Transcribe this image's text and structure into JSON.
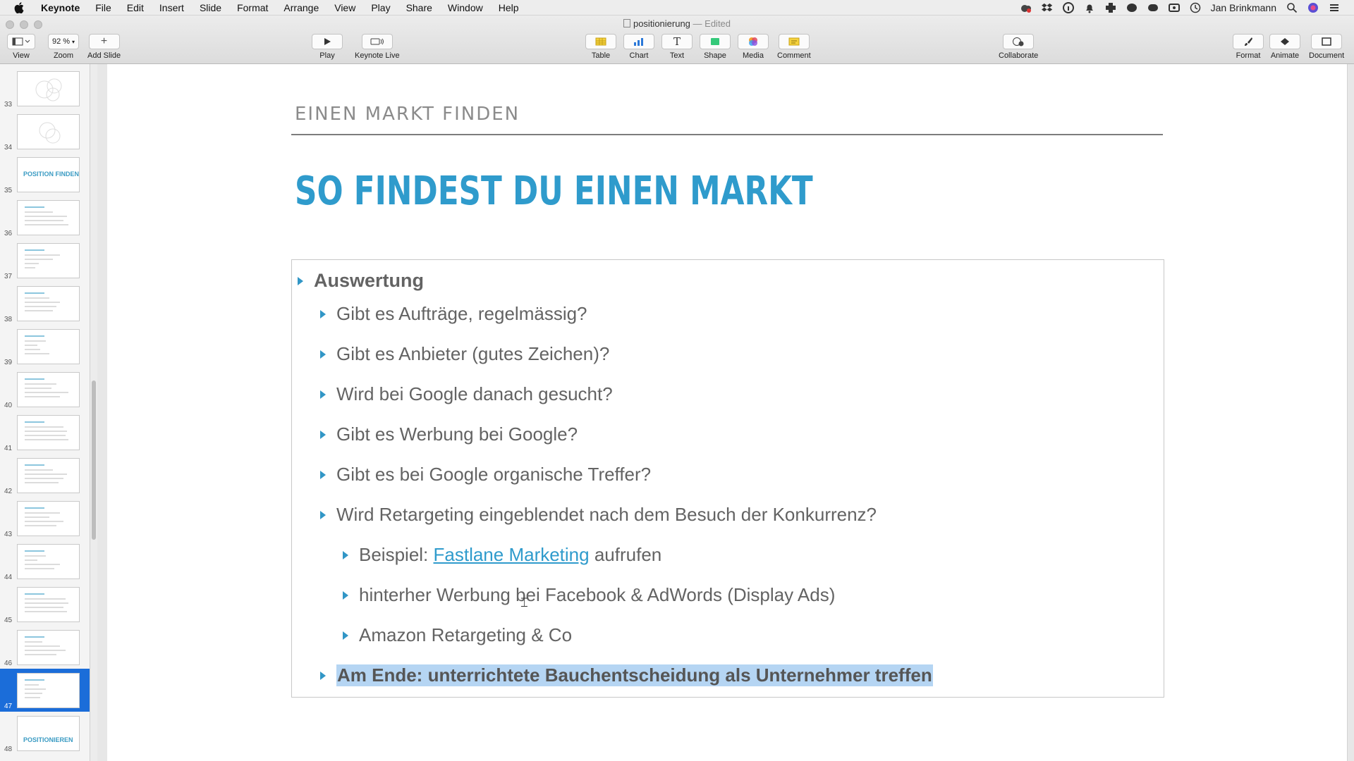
{
  "menubar": {
    "app": "Keynote",
    "items": [
      "File",
      "Edit",
      "Insert",
      "Slide",
      "Format",
      "Arrange",
      "View",
      "Play",
      "Share",
      "Window",
      "Help"
    ],
    "user": "Jan Brinkmann"
  },
  "window": {
    "title": "positionierung",
    "status": "— Edited"
  },
  "toolbar": {
    "view": "View",
    "zoom_value": "92 %",
    "zoom": "Zoom",
    "add_slide": "Add Slide",
    "play": "Play",
    "keynote_live": "Keynote Live",
    "table": "Table",
    "chart": "Chart",
    "text": "Text",
    "shape": "Shape",
    "media": "Media",
    "comment": "Comment",
    "collaborate": "Collaborate",
    "format": "Format",
    "animate": "Animate",
    "document": "Document"
  },
  "sidebar": {
    "slides": [
      {
        "num": "33"
      },
      {
        "num": "34"
      },
      {
        "num": "35",
        "title": "POSITION FINDEN"
      },
      {
        "num": "36"
      },
      {
        "num": "37"
      },
      {
        "num": "38"
      },
      {
        "num": "39"
      },
      {
        "num": "40"
      },
      {
        "num": "41"
      },
      {
        "num": "42"
      },
      {
        "num": "43"
      },
      {
        "num": "44"
      },
      {
        "num": "45"
      },
      {
        "num": "46"
      },
      {
        "num": "47",
        "selected": true
      },
      {
        "num": "48",
        "title": "POSITIONIEREN"
      }
    ]
  },
  "slide": {
    "eyebrow": "EINEN MARKT FINDEN",
    "headline": "SO FINDEST DU EINEN MARKT",
    "bullets": {
      "b0": "Auswertung",
      "b1": "Gibt es Aufträge, regelmässig?",
      "b2": "Gibt es Anbieter (gutes Zeichen)?",
      "b3": "Wird bei Google danach gesucht?",
      "b4": "Gibt es Werbung bei Google?",
      "b5": "Gibt es bei Google organische Treffer?",
      "b6": "Wird Retargeting eingeblendet nach dem Besuch der Konkurrenz?",
      "b7_prefix": "Beispiel: ",
      "b7_link": "Fastlane Marketing",
      "b7_suffix": " aufrufen",
      "b8": "hinterher Werbung bei Facebook & AdWords (Display Ads)",
      "b9": "Amazon Retargeting & Co",
      "b10": "Am Ende: unterrichtete Bauchentscheidung als Unternehmer treffen"
    }
  },
  "colors": {
    "accent": "#2f9bcc",
    "selection": "#1b6dd9",
    "highlight": "#b5d5f3"
  }
}
